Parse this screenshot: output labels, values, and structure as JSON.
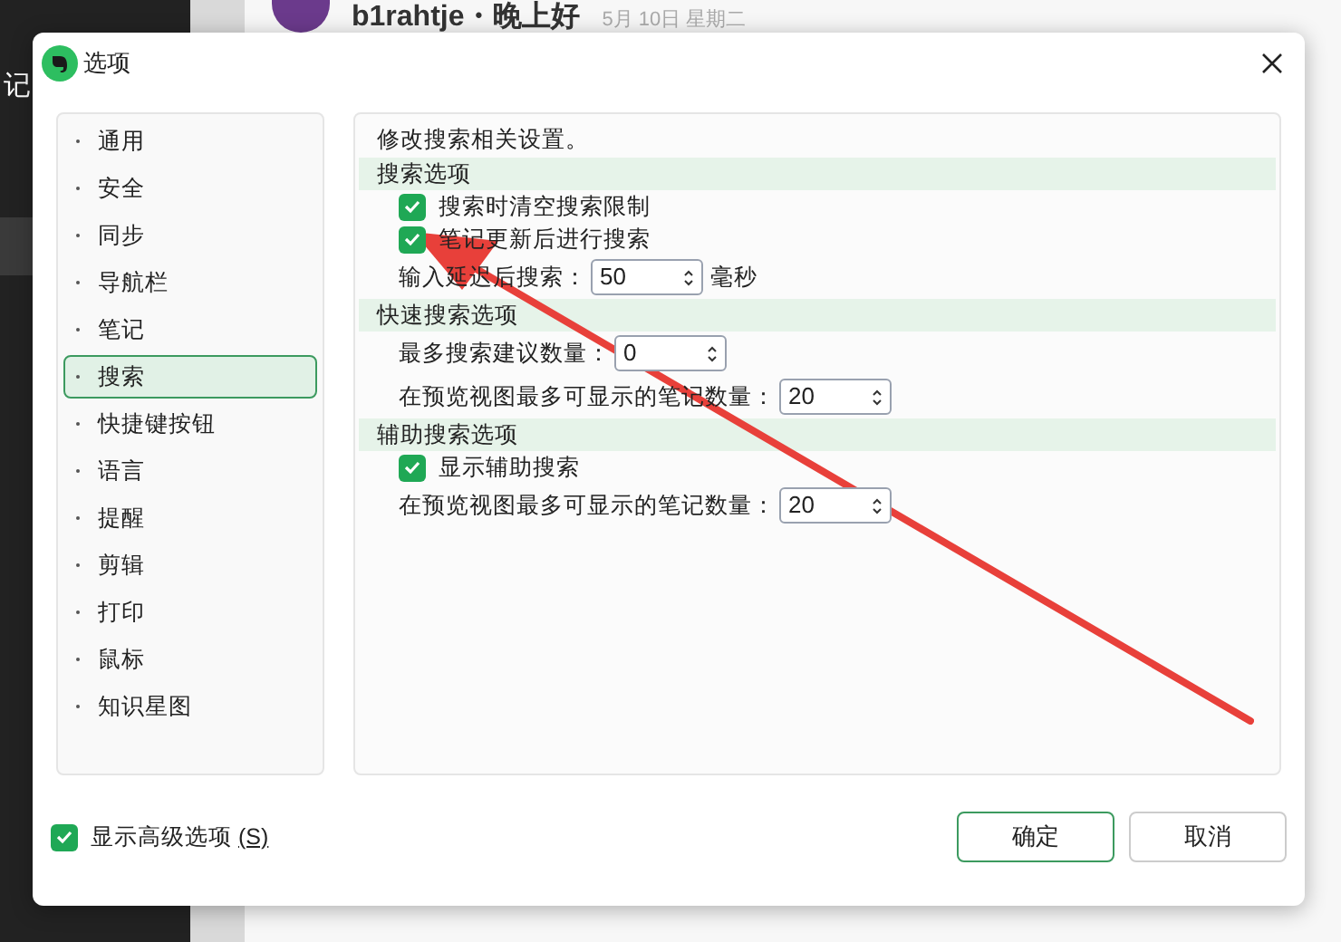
{
  "background": {
    "sidebar_label": "记",
    "greeting": "b1rahtje・晚上好",
    "date": "5月 10日 星期二"
  },
  "dialog": {
    "title": "选项",
    "nav": [
      {
        "label": "通用",
        "selected": false
      },
      {
        "label": "安全",
        "selected": false
      },
      {
        "label": "同步",
        "selected": false
      },
      {
        "label": "导航栏",
        "selected": false
      },
      {
        "label": "笔记",
        "selected": false
      },
      {
        "label": "搜索",
        "selected": true
      },
      {
        "label": "快捷键按钮",
        "selected": false
      },
      {
        "label": "语言",
        "selected": false
      },
      {
        "label": "提醒",
        "selected": false
      },
      {
        "label": "剪辑",
        "selected": false
      },
      {
        "label": "打印",
        "selected": false
      },
      {
        "label": "鼠标",
        "selected": false
      },
      {
        "label": "知识星图",
        "selected": false
      }
    ],
    "description": "修改搜索相关设置。",
    "sections": [
      {
        "title": "搜索选项",
        "rows": [
          {
            "kind": "checkbox",
            "label": "搜索时清空搜索限制",
            "checked": true
          },
          {
            "kind": "checkbox",
            "label": "笔记更新后进行搜索",
            "checked": true
          },
          {
            "kind": "spinner",
            "label": "输入延迟后搜索：",
            "value": "50",
            "unit": "毫秒"
          }
        ]
      },
      {
        "title": "快速搜索选项",
        "rows": [
          {
            "kind": "spinner",
            "label": "最多搜索建议数量：",
            "value": "0"
          },
          {
            "kind": "spinner",
            "label": "在预览视图最多可显示的笔记数量：",
            "value": "20"
          }
        ]
      },
      {
        "title": "辅助搜索选项",
        "rows": [
          {
            "kind": "checkbox",
            "label": "显示辅助搜索",
            "checked": true
          },
          {
            "kind": "spinner",
            "label": "在预览视图最多可显示的笔记数量：",
            "value": "20"
          }
        ]
      }
    ],
    "advanced": {
      "label": "显示高级选项",
      "shortcut": "(S)",
      "checked": true
    },
    "buttons": [
      "确定",
      "取消"
    ]
  }
}
